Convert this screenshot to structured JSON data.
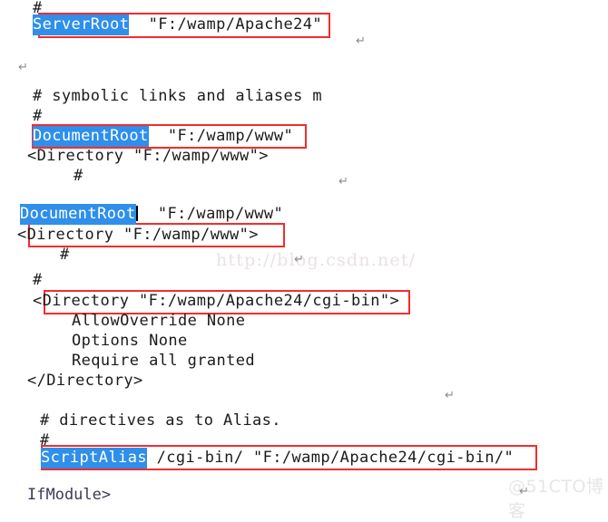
{
  "document": {
    "kind": "apache-httpd-conf-screenshot",
    "colors": {
      "selection_blue": "#2f8fea",
      "annotation_red": "#f42c2c",
      "text": "#1b1b1b",
      "page_background": "#ffffff",
      "return_mark_gray": "#8b8b8b",
      "watermark_gray": "#e9e2e2"
    }
  },
  "lines": {
    "l1_hash": "#",
    "l2_serverroot_key": "ServerRoot",
    "l2_serverroot_value": "  \"F:/wamp/Apache24\"",
    "l3_comment_symbolic": "# symbolic links and aliases m",
    "l4_hash": "#",
    "l5_documentroot_key": "DocumentRoot",
    "l5_documentroot_value": "  \"F:/wamp/www\"",
    "l6_directory_www": "<Directory \"F:/wamp/www\">",
    "l7_hash_indent": "#",
    "l8_documentroot_key": "DocumentRoot",
    "l8_documentroot_value": "  \"F:/wamp/www\"",
    "l9_directory_www": "<Directory \"F:/wamp/www\">",
    "l10_hash_indent": "#",
    "l11_hash": "#",
    "l12_directory_cgibin": "<Directory \"F:/wamp/Apache24/cgi-bin\">",
    "l13_allowoverride": "AllowOverride None",
    "l14_options": "Options None",
    "l15_require": "Require all granted",
    "l16_directory_close": "</Directory>",
    "l17_comment_directives": "# directives as to Alias.",
    "l18_hash": "#",
    "l19_scriptalias_key": "ScriptAlias",
    "l19_scriptalias_value": " /cgi-bin/ \"F:/wamp/Apache24/cgi-bin/\"",
    "l20_ifmodule_clipped": "IfModule>"
  },
  "marks": {
    "return_symbol": "↵"
  },
  "watermarks": {
    "url": "http://blog.csdn.net/",
    "brand": "@51CTO博客"
  }
}
